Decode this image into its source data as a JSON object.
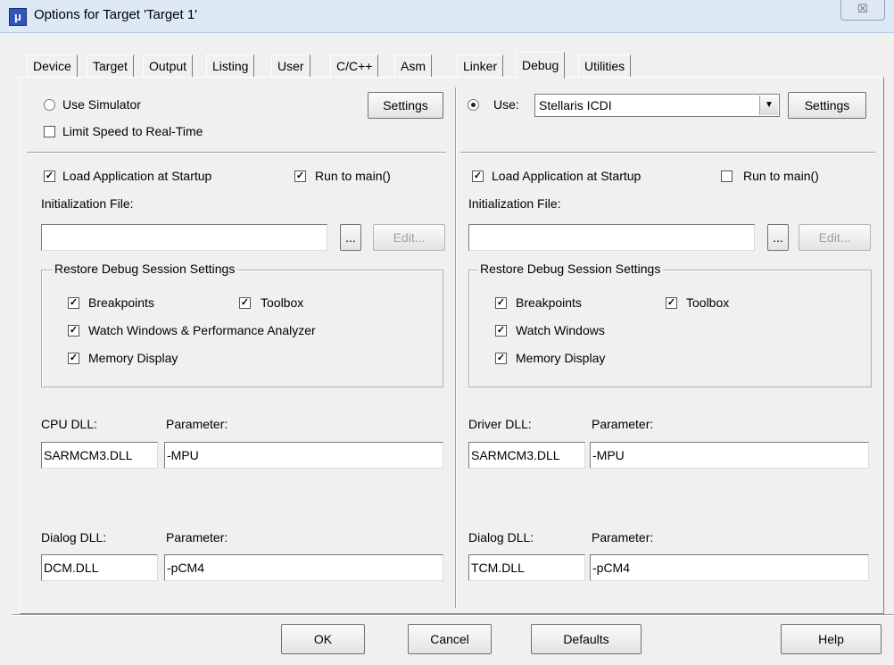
{
  "window": {
    "title": "Options for Target 'Target 1'",
    "app_icon": "keil-uvision-icon",
    "close_glyph": "☒"
  },
  "tabs": [
    "Device",
    "Target",
    "Output",
    "Listing",
    "User",
    "C/C++",
    "Asm",
    "Linker",
    "Debug",
    "Utilities"
  ],
  "active_tab": "Debug",
  "left": {
    "use_simulator": "Use Simulator",
    "limit_speed": "Limit Speed to Real-Time",
    "settings": "Settings",
    "load_app": "Load Application at Startup",
    "run_to_main": "Run to main()",
    "init_file_label": "Initialization File:",
    "init_file_value": "",
    "browse": "...",
    "edit": "Edit...",
    "restore_group": "Restore Debug Session Settings",
    "breakpoints": "Breakpoints",
    "toolbox": "Toolbox",
    "watch": "Watch Windows & Performance Analyzer",
    "memory": "Memory Display",
    "cpu_dll_label": "CPU DLL:",
    "cpu_dll_value": "SARMCM3.DLL",
    "cpu_param_label": "Parameter:",
    "cpu_param_value": "-MPU",
    "dialog_dll_label": "Dialog DLL:",
    "dialog_dll_value": "DCM.DLL",
    "dialog_param_label": "Parameter:",
    "dialog_param_value": "-pCM4"
  },
  "right": {
    "use": "Use:",
    "driver": "Stellaris ICDI",
    "settings": "Settings",
    "load_app": "Load Application at Startup",
    "run_to_main": "Run to main()",
    "init_file_label": "Initialization File:",
    "init_file_value": "",
    "browse": "...",
    "edit": "Edit...",
    "restore_group": "Restore Debug Session Settings",
    "breakpoints": "Breakpoints",
    "toolbox": "Toolbox",
    "watch": "Watch Windows",
    "memory": "Memory Display",
    "driver_dll_label": "Driver DLL:",
    "driver_dll_value": "SARMCM3.DLL",
    "driver_param_label": "Parameter:",
    "driver_param_value": "-MPU",
    "dialog_dll_label": "Dialog DLL:",
    "dialog_dll_value": "TCM.DLL",
    "dialog_param_label": "Parameter:",
    "dialog_param_value": "-pCM4"
  },
  "state": {
    "left_use_simulator": false,
    "left_limit_speed": false,
    "left_load_app": true,
    "left_run_to_main": true,
    "left_breakpoints": true,
    "left_toolbox": true,
    "left_watch": true,
    "left_memory": true,
    "right_use": true,
    "right_load_app": true,
    "right_run_to_main": false,
    "right_breakpoints": true,
    "right_toolbox": true,
    "right_watch": true,
    "right_memory": true
  },
  "footer": {
    "ok": "OK",
    "cancel": "Cancel",
    "defaults": "Defaults",
    "help": "Help"
  },
  "colors": {
    "title_bar": "#dde9f5",
    "dialog_bg": "#f0f0f0",
    "app_icon": "#2f57b8"
  }
}
